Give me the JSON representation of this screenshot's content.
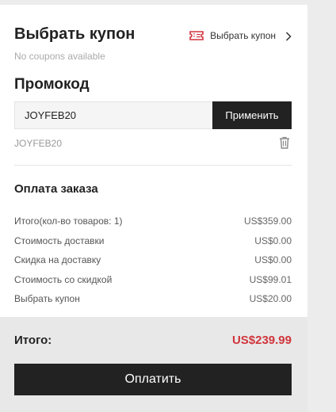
{
  "coupon": {
    "title": "Выбрать купон",
    "select_label": "Выбрать купон",
    "no_coupons": "No coupons available",
    "icon": "ticket-icon",
    "accent_color": "#d0353c"
  },
  "promo": {
    "title": "Промокод",
    "input_value": "JOYFEB20",
    "apply_label": "Применить",
    "applied_code": "JOYFEB20"
  },
  "summary": {
    "title": "Оплата заказа",
    "rows": [
      {
        "label": "Итого(кол-во товаров: 1)",
        "value": "US$359.00"
      },
      {
        "label": "Стоимость доставки",
        "value": "US$0.00"
      },
      {
        "label": "Скидка на доставку",
        "value": "US$0.00"
      },
      {
        "label": "Стоимость со скидкой",
        "value": "US$99.01"
      },
      {
        "label": "Выбрать купон",
        "value": "US$20.00"
      }
    ]
  },
  "total": {
    "label": "Итого:",
    "value": "US$239.99",
    "value_color": "#d0353c"
  },
  "pay_label": "Оплатить"
}
